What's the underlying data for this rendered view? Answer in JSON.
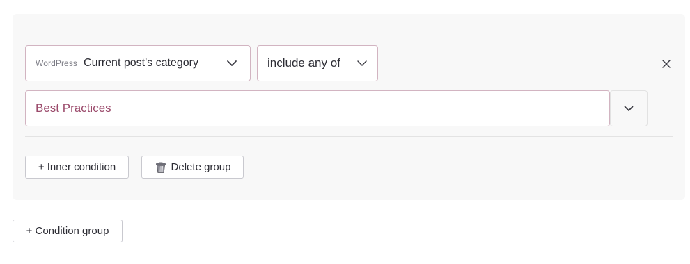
{
  "condition": {
    "source_label": "WordPress",
    "field_value": "Current post's category",
    "field_icon": "chevron-down-icon",
    "operator_value": "include any of",
    "operator_icon": "chevron-down-icon",
    "remove_icon": "close-icon",
    "value_text": "Best Practices",
    "value_toggle_icon": "chevron-down-icon"
  },
  "actions": {
    "inner_condition_label": "+ Inner condition",
    "delete_group_label": "Delete group",
    "delete_icon": "trash-icon"
  },
  "footer": {
    "condition_group_label": "+ Condition group"
  },
  "colors": {
    "panel_bg": "#f8f8f8",
    "select_border": "#d2b4c1",
    "value_text": "#9b4a6b",
    "button_border": "#c9c9cf"
  }
}
